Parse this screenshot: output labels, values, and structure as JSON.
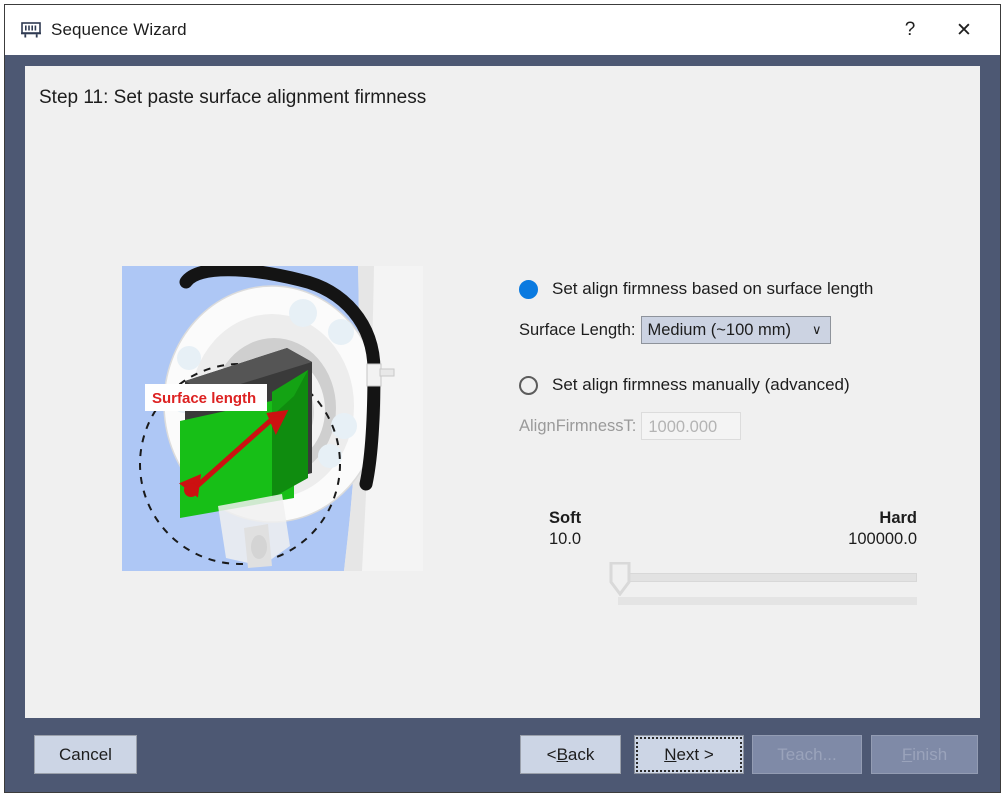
{
  "window": {
    "title": "Sequence Wizard",
    "app_icon": "machine-icon",
    "help_label": "?",
    "close_label": "✕"
  },
  "content": {
    "step_title": "Step 11: Set paste surface alignment firmness"
  },
  "illustration": {
    "alt_name": "robot-flange-surface-length-diagram",
    "annotation_label": "Surface length",
    "background_color": "#aec7f5",
    "arrow_color": "#cc1111",
    "surface_color": "#18c018"
  },
  "options": {
    "auto": {
      "radio_label": "Set align firmness based on surface length",
      "selected": true,
      "field_label": "Surface Length:",
      "combo_value": "Medium (~100 mm)",
      "combo_chevron": "∨",
      "combo_options": [
        "Medium (~100 mm)"
      ]
    },
    "manual": {
      "radio_label": "Set align firmness manually (advanced)",
      "selected": false,
      "field_label": "AlignFirmnessT:",
      "field_value": "1000.000",
      "field_disabled": true
    }
  },
  "slider": {
    "left_label": "Soft",
    "right_label": "Hard",
    "min_value": "10.0",
    "max_value": "100000.0",
    "thumb_percent": 1
  },
  "footer": {
    "cancel": "Cancel",
    "back_prefix": "< ",
    "back_accel": "B",
    "back_suffix": "ack",
    "next_accel": "N",
    "next_suffix": "ext >",
    "teach": "Teach...",
    "finish_accel": "F",
    "finish_suffix": "inish"
  },
  "colors": {
    "frame": "#4d5873",
    "panel": "#f0f0f0",
    "accent_radio": "#0a7ae0",
    "button_face": "#ccd5e5",
    "button_disabled": "#7f8aa7"
  }
}
